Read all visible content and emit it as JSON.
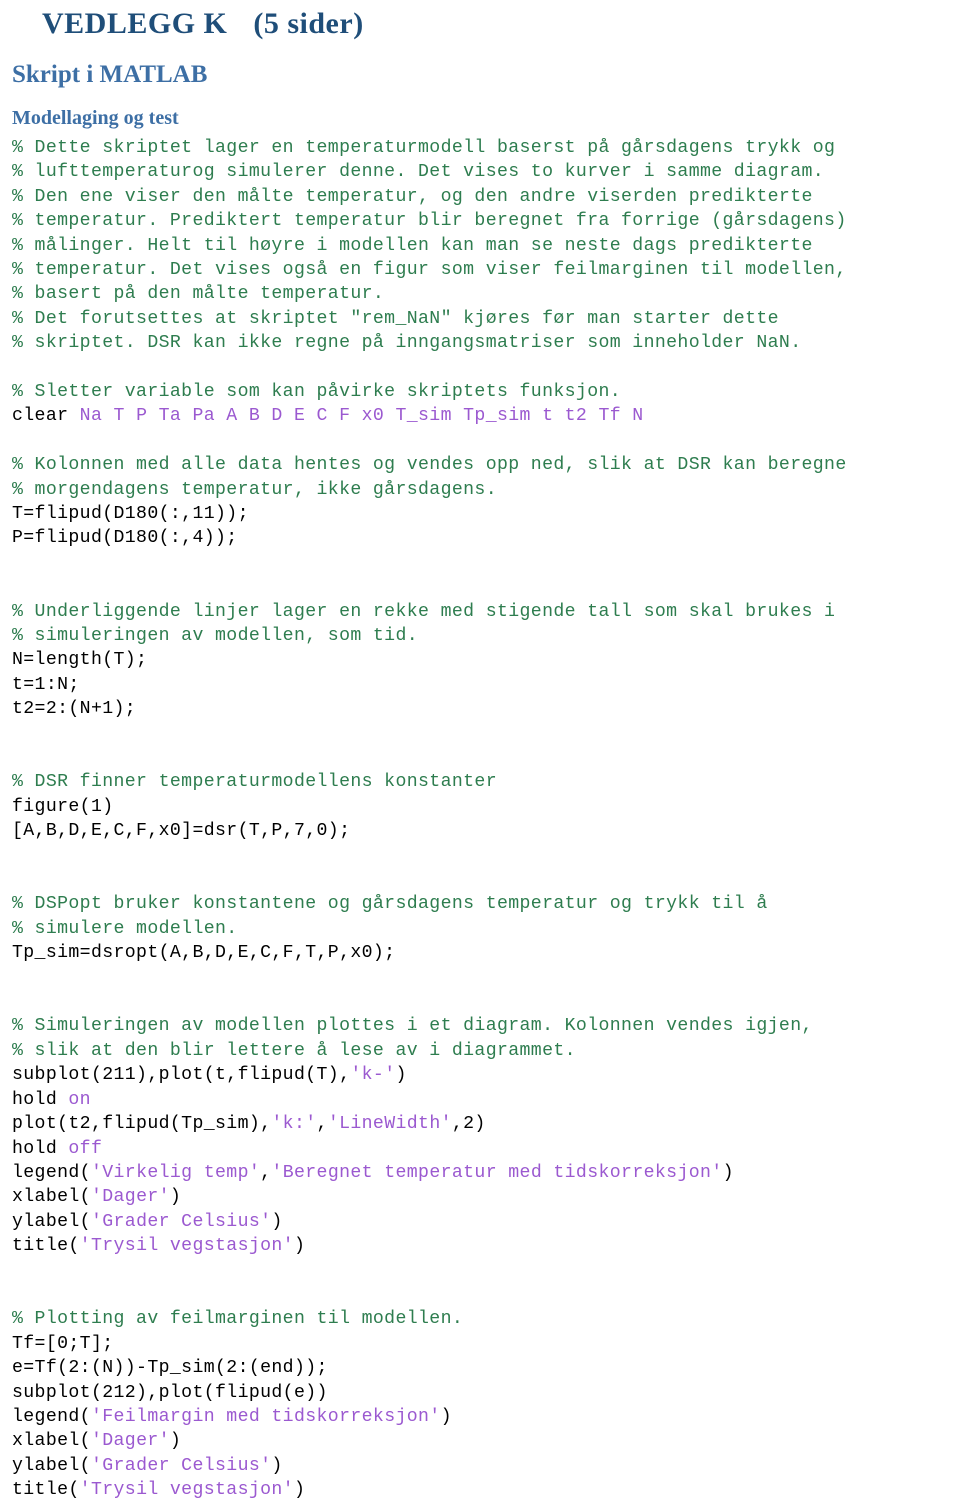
{
  "document": {
    "appendix_title": "VEDLEGG K",
    "appendix_pages": "(5 sider)",
    "section_title": "Skript i MATLAB",
    "subsection_title": "Modellaging og test"
  },
  "colors": {
    "heading_dark_blue": "#1f4e79",
    "heading_blue": "#3d6fa5",
    "comment_green": "#2e7d4f",
    "string_purple": "#9b59d0",
    "code_black": "#000000",
    "page_background": "#ffffff"
  },
  "code": {
    "language": "matlab",
    "lines": [
      {
        "id": "l1",
        "segments": [
          {
            "text": "% Dette skriptet lager en temperaturmodell baserst på gårsdagens trykk og",
            "type": "comment"
          }
        ]
      },
      {
        "id": "l2",
        "segments": [
          {
            "text": "% lufttemperaturog simulerer denne. Det vises to kurver i samme diagram.",
            "type": "comment"
          }
        ]
      },
      {
        "id": "l3",
        "segments": [
          {
            "text": "% Den ene viser den målte temperatur, og den andre viserden predikterte",
            "type": "comment"
          }
        ]
      },
      {
        "id": "l4",
        "segments": [
          {
            "text": "% temperatur. Prediktert temperatur blir beregnet fra forrige (gårsdagens)",
            "type": "comment"
          }
        ]
      },
      {
        "id": "l5",
        "segments": [
          {
            "text": "% målinger. Helt til høyre i modellen kan man se neste dags predikterte",
            "type": "comment"
          }
        ]
      },
      {
        "id": "l6",
        "segments": [
          {
            "text": "% temperatur. Det vises også en figur som viser feilmarginen til modellen,",
            "type": "comment"
          }
        ]
      },
      {
        "id": "l7",
        "segments": [
          {
            "text": "% basert på den målte temperatur.",
            "type": "comment"
          }
        ]
      },
      {
        "id": "l8",
        "segments": [
          {
            "text": "% Det forutsettes at skriptet \"rem_NaN\" kjøres før man starter dette",
            "type": "comment"
          }
        ]
      },
      {
        "id": "l9",
        "segments": [
          {
            "text": "% skriptet. DSR kan ikke regne på inngangsmatriser som inneholder NaN.",
            "type": "comment"
          }
        ]
      },
      {
        "id": "l10",
        "segments": []
      },
      {
        "id": "l11",
        "segments": [
          {
            "text": "% Sletter variable som kan påvirke skriptets funksjon.",
            "type": "comment"
          }
        ]
      },
      {
        "id": "l12",
        "segments": [
          {
            "text": "clear ",
            "type": "plain"
          },
          {
            "text": "Na T P Ta Pa A B D E C F x0 T_sim Tp_sim t t2 Tf N",
            "type": "var"
          }
        ]
      },
      {
        "id": "l13",
        "segments": []
      },
      {
        "id": "l14",
        "segments": [
          {
            "text": "% Kolonnen med alle data hentes og vendes opp ned, slik at DSR kan beregne",
            "type": "comment"
          }
        ]
      },
      {
        "id": "l15",
        "segments": [
          {
            "text": "% morgendagens temperatur, ikke gårsdagens.",
            "type": "comment"
          }
        ]
      },
      {
        "id": "l16",
        "segments": [
          {
            "text": "T=flipud(D180(:,11));",
            "type": "plain"
          }
        ]
      },
      {
        "id": "l17",
        "segments": [
          {
            "text": "P=flipud(D180(:,4));",
            "type": "plain"
          }
        ]
      },
      {
        "id": "l18",
        "segments": []
      },
      {
        "id": "l19",
        "segments": []
      },
      {
        "id": "l20",
        "segments": [
          {
            "text": "% Underliggende linjer lager en rekke med stigende tall som skal brukes i",
            "type": "comment"
          }
        ]
      },
      {
        "id": "l21",
        "segments": [
          {
            "text": "% simuleringen av modellen, som tid.",
            "type": "comment"
          }
        ]
      },
      {
        "id": "l22",
        "segments": [
          {
            "text": "N=length(T);",
            "type": "plain"
          }
        ]
      },
      {
        "id": "l23",
        "segments": [
          {
            "text": "t=1:N;",
            "type": "plain"
          }
        ]
      },
      {
        "id": "l24",
        "segments": [
          {
            "text": "t2=2:(N+1);",
            "type": "plain"
          }
        ]
      },
      {
        "id": "l25",
        "segments": []
      },
      {
        "id": "l26",
        "segments": []
      },
      {
        "id": "l27",
        "segments": [
          {
            "text": "% DSR finner temperaturmodellens konstanter",
            "type": "comment"
          }
        ]
      },
      {
        "id": "l28",
        "segments": [
          {
            "text": "figure(1)",
            "type": "plain"
          }
        ]
      },
      {
        "id": "l29",
        "segments": [
          {
            "text": "[A,B,D,E,C,F,x0]=dsr(T,P,7,0);",
            "type": "plain"
          }
        ]
      },
      {
        "id": "l30",
        "segments": []
      },
      {
        "id": "l31",
        "segments": []
      },
      {
        "id": "l32",
        "segments": [
          {
            "text": "% DSPopt bruker konstantene og gårsdagens temperatur og trykk til å",
            "type": "comment"
          }
        ]
      },
      {
        "id": "l33",
        "segments": [
          {
            "text": "% simulere modellen.",
            "type": "comment"
          }
        ]
      },
      {
        "id": "l34",
        "segments": [
          {
            "text": "Tp_sim=dsropt(A,B,D,E,C,F,T,P,x0);",
            "type": "plain"
          }
        ]
      },
      {
        "id": "l35",
        "segments": []
      },
      {
        "id": "l36",
        "segments": []
      },
      {
        "id": "l37",
        "segments": [
          {
            "text": "% Simuleringen av modellen plottes i et diagram. Kolonnen vendes igjen,",
            "type": "comment"
          }
        ]
      },
      {
        "id": "l38",
        "segments": [
          {
            "text": "% slik at den blir lettere å lese av i diagrammet.",
            "type": "comment"
          }
        ]
      },
      {
        "id": "l39",
        "segments": [
          {
            "text": "subplot(211),plot(t,flipud(T),",
            "type": "plain"
          },
          {
            "text": "'k-'",
            "type": "string"
          },
          {
            "text": ")",
            "type": "plain"
          }
        ]
      },
      {
        "id": "l40",
        "segments": [
          {
            "text": "hold ",
            "type": "plain"
          },
          {
            "text": "on",
            "type": "kw"
          }
        ]
      },
      {
        "id": "l41",
        "segments": [
          {
            "text": "plot(t2,flipud(Tp_sim),",
            "type": "plain"
          },
          {
            "text": "'k:'",
            "type": "string"
          },
          {
            "text": ",",
            "type": "plain"
          },
          {
            "text": "'LineWidth'",
            "type": "string"
          },
          {
            "text": ",2)",
            "type": "plain"
          }
        ]
      },
      {
        "id": "l42",
        "segments": [
          {
            "text": "hold ",
            "type": "plain"
          },
          {
            "text": "off",
            "type": "kw"
          }
        ]
      },
      {
        "id": "l43",
        "segments": [
          {
            "text": "legend(",
            "type": "plain"
          },
          {
            "text": "'Virkelig temp'",
            "type": "string"
          },
          {
            "text": ",",
            "type": "plain"
          },
          {
            "text": "'Beregnet temperatur med tidskorreksjon'",
            "type": "string"
          },
          {
            "text": ")",
            "type": "plain"
          }
        ]
      },
      {
        "id": "l44",
        "segments": [
          {
            "text": "xlabel(",
            "type": "plain"
          },
          {
            "text": "'Dager'",
            "type": "string"
          },
          {
            "text": ")",
            "type": "plain"
          }
        ]
      },
      {
        "id": "l45",
        "segments": [
          {
            "text": "ylabel(",
            "type": "plain"
          },
          {
            "text": "'Grader Celsius'",
            "type": "string"
          },
          {
            "text": ")",
            "type": "plain"
          }
        ]
      },
      {
        "id": "l46",
        "segments": [
          {
            "text": "title(",
            "type": "plain"
          },
          {
            "text": "'Trysil vegstasjon'",
            "type": "string"
          },
          {
            "text": ")",
            "type": "plain"
          }
        ]
      },
      {
        "id": "l47",
        "segments": []
      },
      {
        "id": "l48",
        "segments": []
      },
      {
        "id": "l49",
        "segments": [
          {
            "text": "% Plotting av feilmarginen til modellen.",
            "type": "comment"
          }
        ]
      },
      {
        "id": "l50",
        "segments": [
          {
            "text": "Tf=[0;T];",
            "type": "plain"
          }
        ]
      },
      {
        "id": "l51",
        "segments": [
          {
            "text": "e=Tf(2:(N))-Tp_sim(2:(end));",
            "type": "plain"
          }
        ]
      },
      {
        "id": "l52",
        "segments": [
          {
            "text": "subplot(212),plot(flipud(e))",
            "type": "plain"
          }
        ]
      },
      {
        "id": "l53",
        "segments": [
          {
            "text": "legend(",
            "type": "plain"
          },
          {
            "text": "'Feilmargin med tidskorreksjon'",
            "type": "string"
          },
          {
            "text": ")",
            "type": "plain"
          }
        ]
      },
      {
        "id": "l54",
        "segments": [
          {
            "text": "xlabel(",
            "type": "plain"
          },
          {
            "text": "'Dager'",
            "type": "string"
          },
          {
            "text": ")",
            "type": "plain"
          }
        ]
      },
      {
        "id": "l55",
        "segments": [
          {
            "text": "ylabel(",
            "type": "plain"
          },
          {
            "text": "'Grader Celsius'",
            "type": "string"
          },
          {
            "text": ")",
            "type": "plain"
          }
        ]
      },
      {
        "id": "l56",
        "segments": [
          {
            "text": "title(",
            "type": "plain"
          },
          {
            "text": "'Trysil vegstasjon'",
            "type": "string"
          },
          {
            "text": ")",
            "type": "plain"
          }
        ]
      }
    ]
  }
}
